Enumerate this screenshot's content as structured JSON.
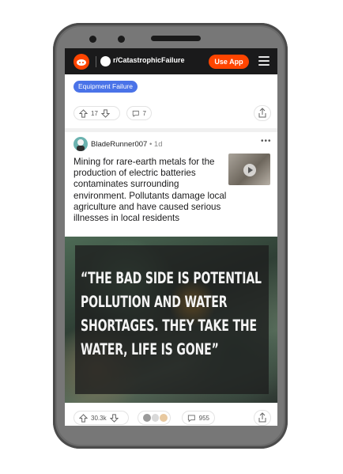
{
  "topbar": {
    "subreddit": "r/CatastrophicFailure",
    "use_app_label": "Use App"
  },
  "prev_post": {
    "flair": "Equipment Failure",
    "votes": "17",
    "comments": "7"
  },
  "post": {
    "username": "BladeRunner007",
    "time_ago": "1d",
    "separator": "•",
    "title": "Mining for rare-earth metals for the production of electric batteries contaminates surrounding environment. Pollutants damage local agriculture and have caused serious illnesses in local residents",
    "quote": "“THE BAD SIDE IS POTENTIAL POLLUTION AND WATER SHORTAGES. THEY TAKE THE  WATER, LIFE IS GONE”",
    "votes": "30.3k",
    "comments": "955"
  },
  "colors": {
    "reddit_orange": "#ff4500",
    "flair_blue": "#4a73e8",
    "topbar_dark": "#1a1a1b"
  }
}
